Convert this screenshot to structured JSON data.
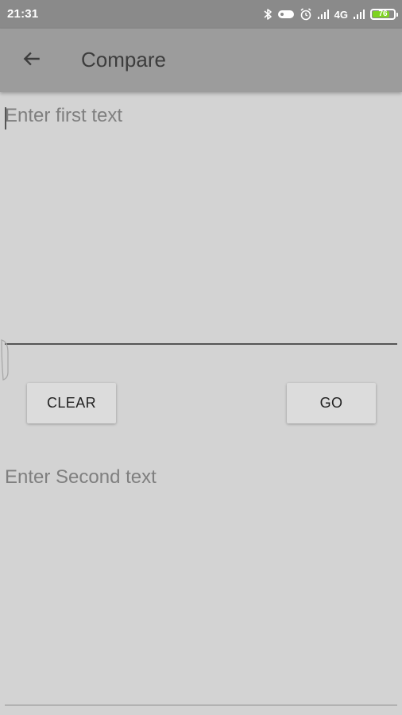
{
  "status_bar": {
    "time": "21:31",
    "network": "4G",
    "battery_level": "76",
    "icons": [
      "bluetooth-icon",
      "vpn-key-icon",
      "alarm-icon",
      "signal-icon",
      "signal-icon"
    ]
  },
  "app_bar": {
    "title": "Compare",
    "back_icon": "arrow-left-icon"
  },
  "first_text": {
    "value": "",
    "placeholder": "Enter first text"
  },
  "second_text": {
    "value": "",
    "placeholder": "Enter Second text"
  },
  "buttons": {
    "clear_label": "CLEAR",
    "go_label": "GO"
  },
  "colors": {
    "status_bar": "#8a8a8a",
    "app_bar": "#9c9c9c",
    "background": "#d3d3d3",
    "button": "#dcdcdc",
    "battery": "#7ed321"
  }
}
